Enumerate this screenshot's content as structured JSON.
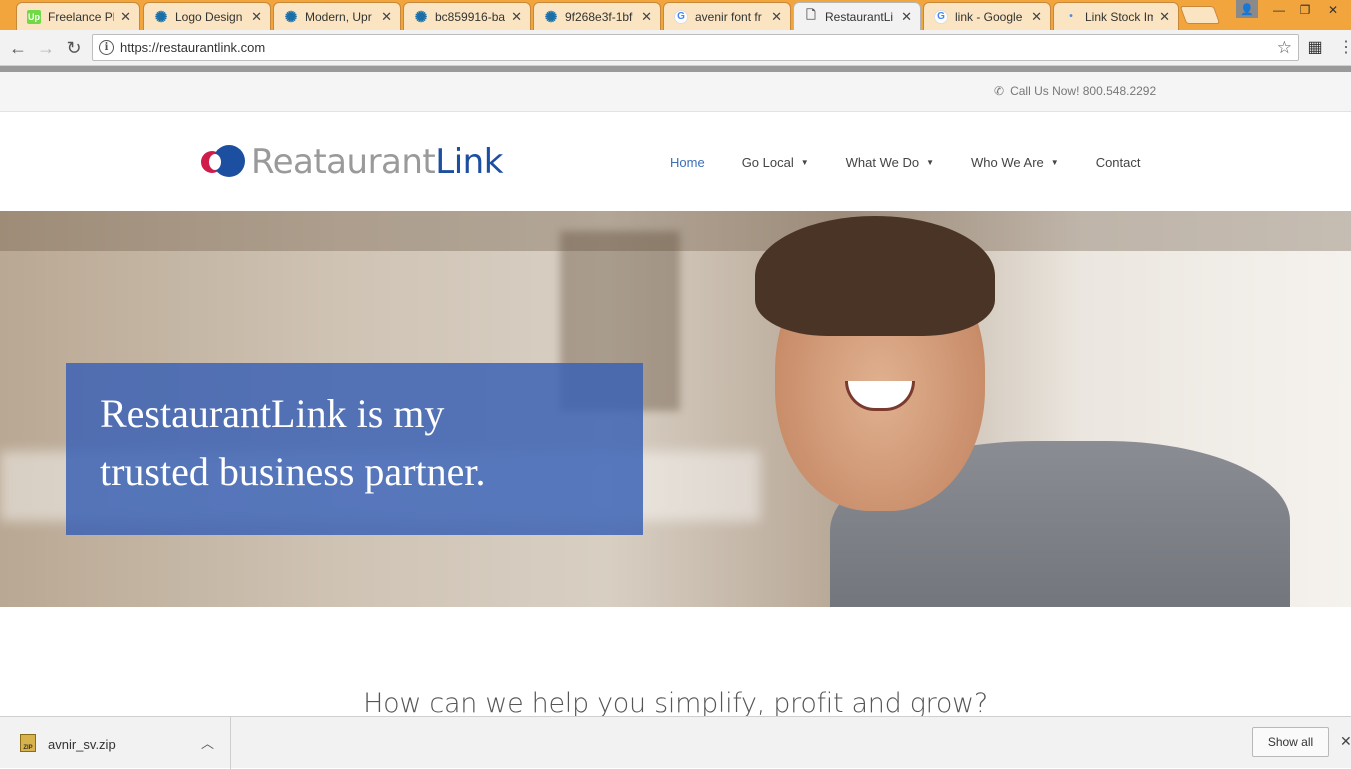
{
  "browser": {
    "tabs": [
      {
        "title": "Freelance Ph",
        "favicon": "upwork-icon"
      },
      {
        "title": "Logo Design",
        "favicon": "star-burst-icon"
      },
      {
        "title": "Modern, Upr",
        "favicon": "star-burst-icon"
      },
      {
        "title": "bc859916-ba",
        "favicon": "star-burst-icon"
      },
      {
        "title": "9f268e3f-1bf",
        "favicon": "star-burst-icon"
      },
      {
        "title": "avenir font fr",
        "favicon": "google-icon"
      },
      {
        "title": "RestaurantLi",
        "favicon": "document-icon"
      },
      {
        "title": "link - Google",
        "favicon": "google-icon"
      },
      {
        "title": "Link Stock Im",
        "favicon": "dot-icon"
      }
    ],
    "url": "https://restaurantlink.com"
  },
  "page": {
    "callus": "Call Us Now! 800.548.2292",
    "logo": {
      "part1": "Reataurant",
      "part2": "Link"
    },
    "nav": [
      {
        "label": "Home",
        "active": true,
        "dropdown": false
      },
      {
        "label": "Go Local",
        "active": false,
        "dropdown": true
      },
      {
        "label": "What We Do",
        "active": false,
        "dropdown": true
      },
      {
        "label": "Who We Are",
        "active": false,
        "dropdown": true
      },
      {
        "label": "Contact",
        "active": false,
        "dropdown": false
      }
    ],
    "hero": {
      "line1": "RestaurantLink is my",
      "line2": "trusted business partner."
    },
    "section_heading": "How can we help you simplify, profit and grow?"
  },
  "downloads": {
    "file": "avnir_sv.zip",
    "show_all": "Show all"
  },
  "colors": {
    "brand_blue": "#1d4fa0",
    "brand_red": "#d01c4a",
    "nav_active": "#3b6fb6",
    "tabstrip": "#f2a53c"
  }
}
